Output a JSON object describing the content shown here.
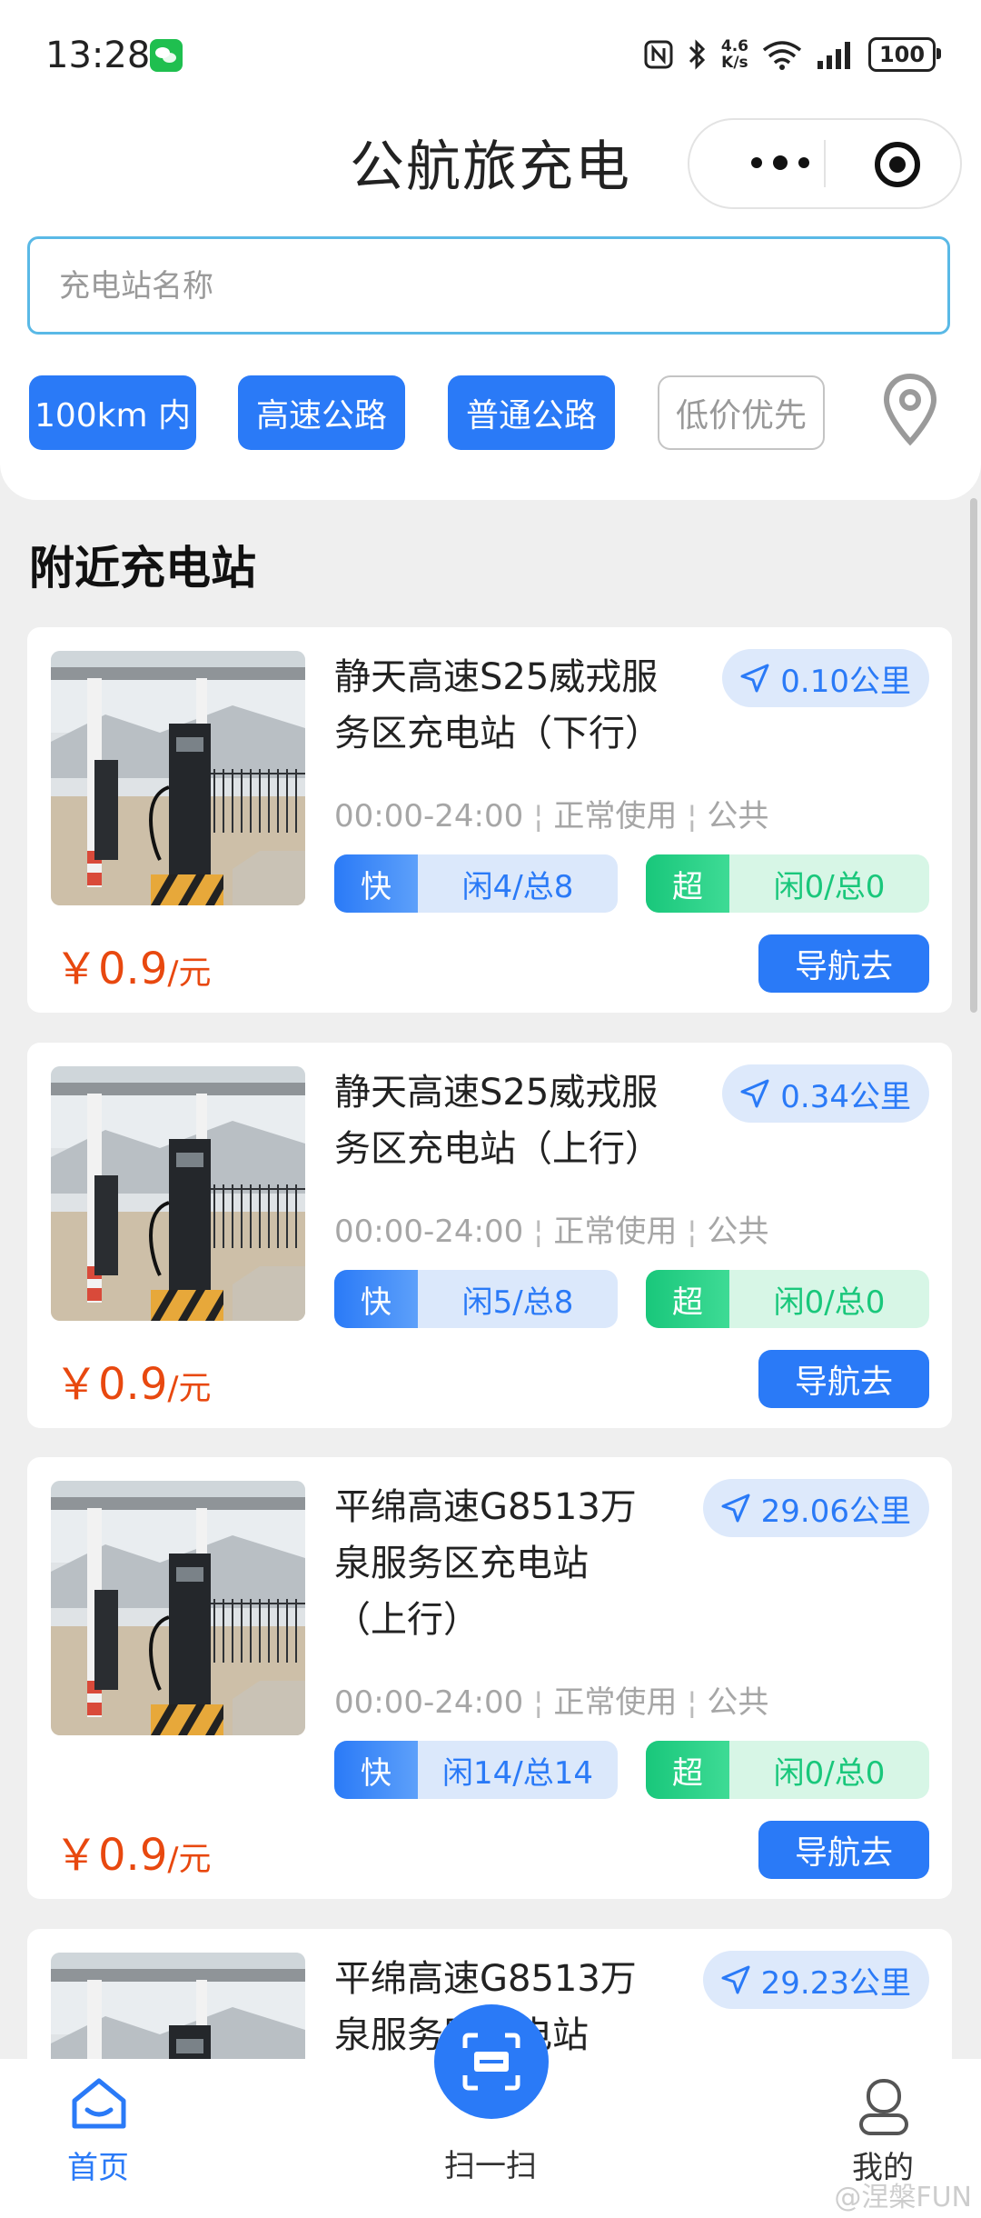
{
  "status_bar": {
    "time": "13:28",
    "network_speed_value": "4.6",
    "network_speed_unit": "K/s",
    "battery": "100"
  },
  "app": {
    "title": "公航旅充电"
  },
  "search": {
    "placeholder": "充电站名称",
    "value": ""
  },
  "filters": [
    {
      "label": "100km 内",
      "active": true
    },
    {
      "label": "高速公路",
      "active": true
    },
    {
      "label": "普通公路",
      "active": true
    },
    {
      "label": "低价优先",
      "active": false
    }
  ],
  "section_title": "附近充电站",
  "stations": [
    {
      "name_line1": "静天高速S25威戎服",
      "name_line2": "务区充电站（下行）",
      "name_line3": "",
      "distance": "0.10公里",
      "hours": "00:00-24:00",
      "status": "正常使用",
      "access": "公共",
      "fast_label": "快",
      "fast_count": "闲4/总8",
      "super_label": "超",
      "super_count": "闲0/总0",
      "currency": "￥",
      "price": "0.9",
      "unit": "/元",
      "nav_label": "导航去"
    },
    {
      "name_line1": "静天高速S25威戎服",
      "name_line2": "务区充电站（上行）",
      "name_line3": "",
      "distance": "0.34公里",
      "hours": "00:00-24:00",
      "status": "正常使用",
      "access": "公共",
      "fast_label": "快",
      "fast_count": "闲5/总8",
      "super_label": "超",
      "super_count": "闲0/总0",
      "currency": "￥",
      "price": "0.9",
      "unit": "/元",
      "nav_label": "导航去"
    },
    {
      "name_line1": "平绵高速G8513万",
      "name_line2": "泉服务区充电站",
      "name_line3": "（上行）",
      "distance": "29.06公里",
      "hours": "00:00-24:00",
      "status": "正常使用",
      "access": "公共",
      "fast_label": "快",
      "fast_count": "闲14/总14",
      "super_label": "超",
      "super_count": "闲0/总0",
      "currency": "￥",
      "price": "0.9",
      "unit": "/元",
      "nav_label": "导航去"
    },
    {
      "name_line1": "平绵高速G8513万",
      "name_line2": "泉服务区充电站",
      "distance": "29.23公里"
    }
  ],
  "tabbar": {
    "home": "首页",
    "scan": "扫一扫",
    "mine": "我的"
  },
  "watermark": "@涅槃FUN",
  "colors": {
    "primary": "#2a7af7",
    "super_green": "#19c77b",
    "price_orange": "#e8480f",
    "search_border": "#5ab9e6"
  }
}
